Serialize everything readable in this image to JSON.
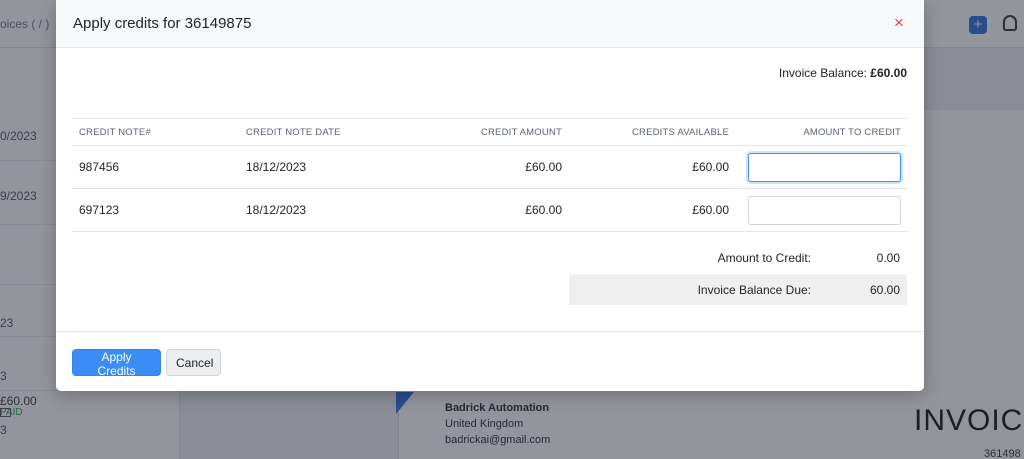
{
  "background": {
    "breadcrumb": "oices ( / )",
    "rows": [
      {
        "date": "0/2023"
      },
      {
        "date": "9/2023"
      },
      {
        "date": "23"
      },
      {
        "date": "3"
      },
      {
        "date": "3",
        "amount": "£60.00",
        "status": "PAID"
      }
    ],
    "company": {
      "name": "Badrick Automation",
      "country": "United Kingdom",
      "email": "badrickai@gmail.com"
    },
    "invoice_heading": "INVOICE",
    "invoice_number": "361498"
  },
  "modal": {
    "title": "Apply credits for 36149875",
    "invoice_balance_label": "Invoice Balance:",
    "invoice_balance_value": "£60.00",
    "table": {
      "headers": {
        "note": "CREDIT NOTE#",
        "date": "CREDIT NOTE DATE",
        "amount": "CREDIT AMOUNT",
        "available": "CREDITS AVAILABLE",
        "to_credit": "AMOUNT TO CREDIT"
      },
      "rows": [
        {
          "note": "987456",
          "date": "18/12/2023",
          "amount": "£60.00",
          "available": "£60.00",
          "to_credit": ""
        },
        {
          "note": "697123",
          "date": "18/12/2023",
          "amount": "£60.00",
          "available": "£60.00",
          "to_credit": ""
        }
      ]
    },
    "summary": {
      "amount_to_credit_label": "Amount to Credit:",
      "amount_to_credit_value": "0.00",
      "balance_due_label": "Invoice Balance Due:",
      "balance_due_value": "60.00"
    },
    "buttons": {
      "apply": "Apply Credits",
      "cancel": "Cancel"
    },
    "close_icon": "×"
  },
  "colors": {
    "primary": "#3b8cf5",
    "close": "#e0453a",
    "paid": "#2e9b4f"
  }
}
